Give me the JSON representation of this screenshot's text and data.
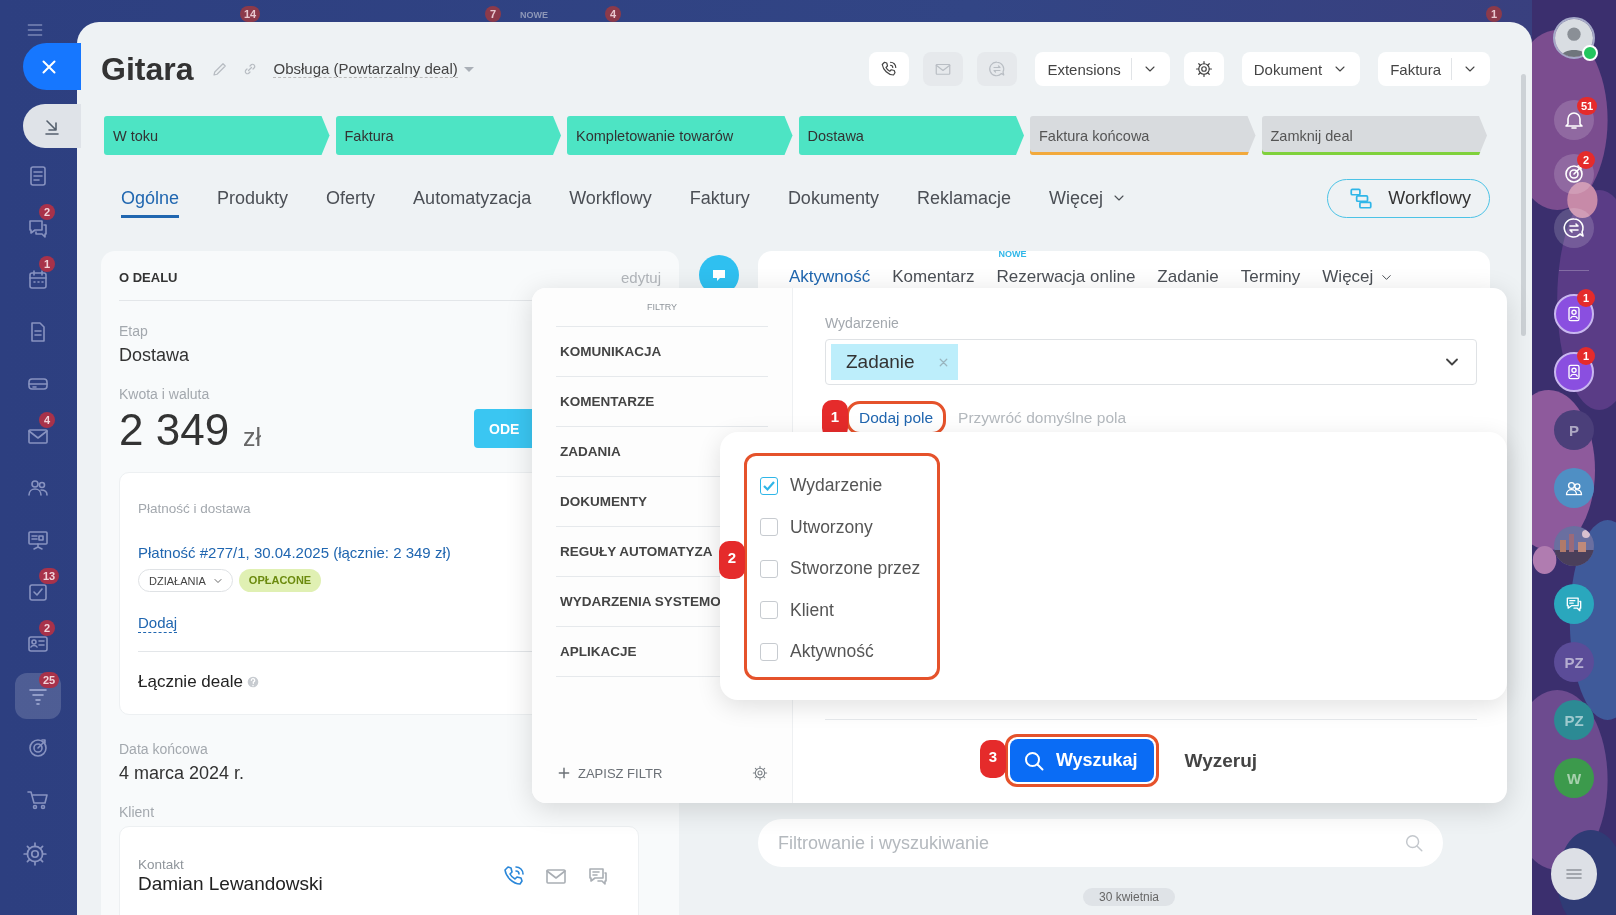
{
  "backdrop_badges": [
    {
      "kind": "count",
      "text": "14"
    },
    {
      "kind": "count",
      "text": "7"
    },
    {
      "kind": "label",
      "text": "NOWE"
    },
    {
      "kind": "count",
      "text": "4"
    },
    {
      "kind": "count",
      "text": "1"
    }
  ],
  "left_sidebar": {
    "items": [
      {
        "kind": "document",
        "selected": false
      },
      {
        "kind": "chat",
        "badge": "2",
        "selected": false
      },
      {
        "kind": "calendar",
        "badge": "1",
        "selected": false
      },
      {
        "kind": "file",
        "selected": false
      },
      {
        "kind": "drive",
        "selected": false
      },
      {
        "kind": "mail",
        "badge": "4",
        "selected": false
      },
      {
        "kind": "people",
        "selected": false
      },
      {
        "kind": "board",
        "selected": false
      },
      {
        "kind": "tasks",
        "badge": "13",
        "selected": false
      },
      {
        "kind": "card",
        "badge": "2",
        "selected": false
      },
      {
        "kind": "funnel",
        "badge": "25",
        "selected": true
      },
      {
        "kind": "target",
        "selected": false
      },
      {
        "kind": "cart",
        "selected": false
      }
    ]
  },
  "header": {
    "title": "Gitara",
    "pipeline": "Obsługa (Powtarzalny deal)",
    "actions": [
      {
        "kind": "phone",
        "disabled": false
      },
      {
        "kind": "mail",
        "disabled": true
      },
      {
        "kind": "chat",
        "disabled": true
      },
      {
        "kind": "split",
        "label": "Extensions",
        "disabled": false
      },
      {
        "kind": "settings",
        "disabled": false
      },
      {
        "kind": "menu",
        "label": "Dokument",
        "disabled": false
      },
      {
        "kind": "split",
        "label": "Faktura",
        "disabled": false
      }
    ]
  },
  "stages": [
    {
      "label": "W toku",
      "passed": true,
      "color": "#4de4c4"
    },
    {
      "label": "Faktura",
      "passed": true,
      "color": "#4de4c4"
    },
    {
      "label": "Kompletowanie towarów",
      "passed": true,
      "color": "#4de4c4"
    },
    {
      "label": "Dostawa",
      "passed": true,
      "color": "#4de4c4"
    },
    {
      "label": "Faktura końcowa",
      "passed": false,
      "color": "#f2a93b"
    },
    {
      "label": "Zamknij deal",
      "passed": false,
      "color": "#7fd13b"
    }
  ],
  "tabs": [
    {
      "label": "Ogólne",
      "selected": true
    },
    {
      "label": "Produkty",
      "selected": false
    },
    {
      "label": "Oferty",
      "selected": false
    },
    {
      "label": "Automatyzacja",
      "selected": false
    },
    {
      "label": "Workflowy",
      "selected": false
    },
    {
      "label": "Faktury",
      "selected": false
    },
    {
      "label": "Dokumenty",
      "selected": false
    },
    {
      "label": "Reklamacje",
      "selected": false
    },
    {
      "label": "Więcej",
      "selected": false,
      "menu": true
    }
  ],
  "workflow_button": "Workflowy",
  "deal_card": {
    "heading": "O DEALU",
    "edit": "edytuj",
    "stage_label": "Etap",
    "stage": "Dostawa",
    "amount_label": "Kwota i waluta",
    "amount": "2 349",
    "currency": "zł",
    "pay_button": "ODE",
    "payment": {
      "heading": "Płatność i dostawa",
      "link": "Płatność #277/1, 30.04.2025 (łącznie: 2 349 zł)",
      "actions": "DZIAŁANIA",
      "status": "OPŁACONE",
      "add": "Dodaj",
      "total": "Łącznie deale"
    },
    "end_date_label": "Data końcowa",
    "end_date": "4 marca 2024 r.",
    "client_label": "Klient",
    "contact": {
      "label": "Kontakt",
      "name": "Damian Lewandowski"
    }
  },
  "timeline": {
    "tabs": [
      {
        "label": "Aktywność",
        "selected": true
      },
      {
        "label": "Komentarz",
        "selected": false
      },
      {
        "label": "Rezerwacja online",
        "selected": false,
        "badge": "NOWE"
      },
      {
        "label": "Zadanie",
        "selected": false
      },
      {
        "label": "Terminy",
        "selected": false
      },
      {
        "label": "Więcej",
        "selected": false,
        "menu": true
      }
    ],
    "search_placeholder": "Filtrowanie i wyszukiwanie",
    "date": "30 kwietnia"
  },
  "filter": {
    "title": "FILTRY",
    "presets": [
      "KOMUNIKACJA",
      "KOMENTARZE",
      "ZADANIA",
      "DOKUMENTY",
      "REGUŁY AUTOMATYZA",
      "WYDARZENIA SYSTEMO",
      "APLIKACJE"
    ],
    "save": "ZAPISZ FILTR",
    "field_label": "Wydarzenie",
    "tags": [
      "Zadanie"
    ],
    "add_field": "Dodaj pole",
    "restore": "Przywróć domyślne pola",
    "fields": [
      {
        "label": "Wydarzenie",
        "checked": true
      },
      {
        "label": "Utworzony",
        "checked": false
      },
      {
        "label": "Stworzone przez",
        "checked": false
      },
      {
        "label": "Klient",
        "checked": false
      },
      {
        "label": "Aktywność",
        "checked": false
      }
    ],
    "search_button": "Wyszukaj",
    "reset_button": "Wyzeruj"
  },
  "annotations": [
    "1",
    "2",
    "3"
  ],
  "right_sidebar": {
    "items": [
      {
        "kind": "avatar",
        "online": true
      },
      {
        "kind": "bell",
        "badge": "51"
      },
      {
        "kind": "target",
        "badge": "2"
      },
      {
        "kind": "chat"
      },
      {
        "kind": "divider"
      },
      {
        "kind": "contact",
        "badge": "1",
        "color": "#8a4fe0"
      },
      {
        "kind": "contact",
        "badge": "1",
        "color": "#8a4fe0"
      },
      {
        "kind": "initials",
        "text": "P",
        "color": "#4b3f7a"
      },
      {
        "kind": "people",
        "color": "#4f8fc4"
      },
      {
        "kind": "picture"
      },
      {
        "kind": "message",
        "color": "#2aa7bd"
      },
      {
        "kind": "initials",
        "text": "PZ",
        "color": "#5b4c98"
      },
      {
        "kind": "initials",
        "text": "PZ",
        "color": "#2c8a94"
      },
      {
        "kind": "initials",
        "text": "W",
        "color": "#3c9a4c"
      },
      {
        "kind": "menu"
      }
    ]
  }
}
